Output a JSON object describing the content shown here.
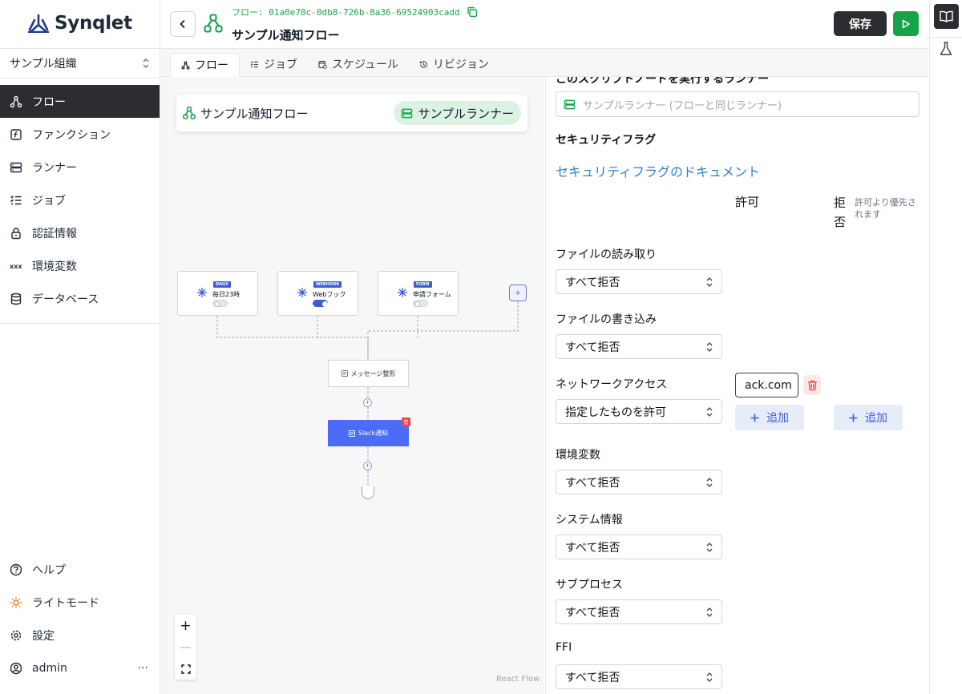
{
  "brand": {
    "name": "Synqlet"
  },
  "org": {
    "name": "サンプル組織"
  },
  "sidebar": {
    "items": [
      {
        "label": "フロー",
        "icon": "flow-icon"
      },
      {
        "label": "ファンクション",
        "icon": "function-icon"
      },
      {
        "label": "ランナー",
        "icon": "server-icon"
      },
      {
        "label": "ジョブ",
        "icon": "list-check-icon"
      },
      {
        "label": "認証情報",
        "icon": "lock-icon"
      },
      {
        "label": "環境変数",
        "icon": "variable-icon"
      },
      {
        "label": "データベース",
        "icon": "database-icon"
      }
    ],
    "bottom": [
      {
        "label": "ヘルプ",
        "icon": "help-icon"
      },
      {
        "label": "ライトモード",
        "icon": "sun-icon"
      },
      {
        "label": "設定",
        "icon": "gear-icon"
      },
      {
        "label": "admin",
        "icon": "user-icon",
        "more": "···"
      }
    ]
  },
  "header": {
    "path": "フロー: 01a0e70c-0db8-726b-8a36-69524903cadd",
    "title": "サンプル通知フロー",
    "save_label": "保存"
  },
  "tabs": [
    {
      "label": "フロー",
      "active": true
    },
    {
      "label": "ジョブ"
    },
    {
      "label": "スケジュール"
    },
    {
      "label": "リビジョン"
    }
  ],
  "canvas": {
    "flow_name": "サンプル通知フロー",
    "runner_name": "サンプルランナー",
    "triggers": [
      {
        "tag": "DAILY",
        "name": "毎日23時",
        "enabled": false
      },
      {
        "tag": "WEBHOOK",
        "name": "Webフック",
        "enabled": true
      },
      {
        "tag": "FORM",
        "name": "申請フォーム",
        "enabled": false
      }
    ],
    "add_trigger": "+",
    "nodes": [
      {
        "label": "メッセージ整形"
      },
      {
        "label": "Slack通知",
        "selected": true
      }
    ],
    "zoom": {
      "in": "+",
      "out": "—"
    },
    "attribution": "React Flow"
  },
  "panel": {
    "runner_label": "このスクリプトノードを実行するランナー",
    "runner_placeholder": "サンプルランナー (フローと同じランナー)",
    "security_title": "セキュリティフラグ",
    "security_link": "セキュリティフラグのドキュメント",
    "col_allow": "許可",
    "col_deny": "拒否",
    "col_deny_note": "許可より優先されます",
    "permissions": [
      {
        "label": "ファイルの読み取り",
        "value": "すべて拒否"
      },
      {
        "label": "ファイルの書き込み",
        "value": "すべて拒否"
      },
      {
        "label": "ネットワークアクセス",
        "value": "指定したものを許可"
      },
      {
        "label": "環境変数",
        "value": "すべて拒否"
      },
      {
        "label": "システム情報",
        "value": "すべて拒否"
      },
      {
        "label": "サブプロセス",
        "value": "すべて拒否"
      },
      {
        "label": "FFI",
        "value": "すべて拒否"
      }
    ],
    "network_allow_host": "ack.com",
    "add_label": "追加"
  },
  "colors": {
    "accent_green": "#16a34a",
    "accent_blue": "#4a6cf7",
    "link": "#2c84c8",
    "dark": "#2b2d31"
  }
}
